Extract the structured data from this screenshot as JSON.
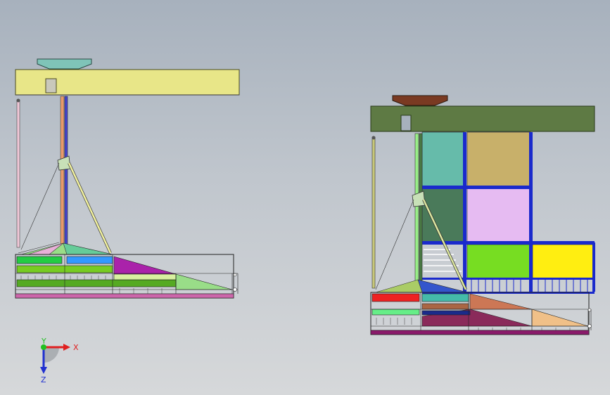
{
  "viewport": {
    "background_top": "#a7b1bd",
    "background_bottom": "#d6d8da"
  },
  "models": [
    {
      "name": "left-assembly",
      "beam_color": "#e8e688",
      "base_color": "#7fc4b8",
      "platform_colors": [
        "#22cc44",
        "#3399ff",
        "#aa22aa",
        "#77cc22",
        "#99dd88"
      ]
    },
    {
      "name": "right-assembly",
      "beam_color": "#5e7a44",
      "base_color": "#7a3a22",
      "panel_colors": [
        "#66bbaa",
        "#c8b06a",
        "#4a7a5a",
        "#e6bbf2",
        "#77dd22",
        "#ffee11",
        "#1a2acc"
      ]
    }
  ],
  "triad": {
    "x_label": "X",
    "y_label": "Y",
    "z_label": "Z",
    "x_color": "#e02020",
    "y_color": "#20c020",
    "z_color": "#2030d0"
  }
}
